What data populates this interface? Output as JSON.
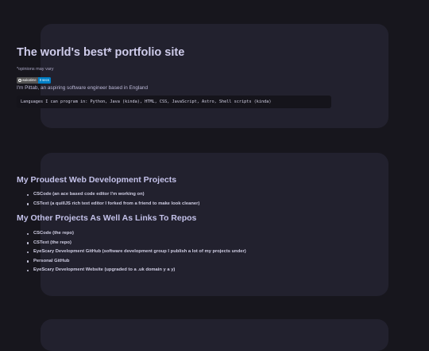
{
  "hero": {
    "title": "The world's best* portfolio site",
    "disclaimer": "*opinions may vary",
    "badge": {
      "label": "wakatime",
      "value": "0 secs",
      "label_color": "#555555",
      "value_color": "#007ec6"
    },
    "intro": "I'm Pittab, an aspiring software engineer based in England",
    "code": "Languages I can program in: Python, Java (kinda), HTML, CSS, JavaScript, Astro, Shell scripts (kinda)"
  },
  "projects": {
    "proudest_title": "My Proudest Web Development Projects",
    "proudest_items": [
      "CSCode (an ace based code editor I'm working on)",
      "CSText (a quillJS rich text editor I forked from a friend to make look cleaner)"
    ],
    "other_title": "My Other Projects As Well As Links To Repos",
    "other_items": [
      "CSCode (the repo)",
      "CSText (the repo)",
      "EyeScary Development GitHub (software development group I publish a lot of my projects under)",
      "Personal GitHub",
      "EyeScary Development Website (upgraded to a .uk domain y a y)"
    ]
  },
  "colors": {
    "background": "#17161d",
    "card": "#22212e",
    "heading": "#c4c2ea",
    "code_background": "#15141b"
  }
}
